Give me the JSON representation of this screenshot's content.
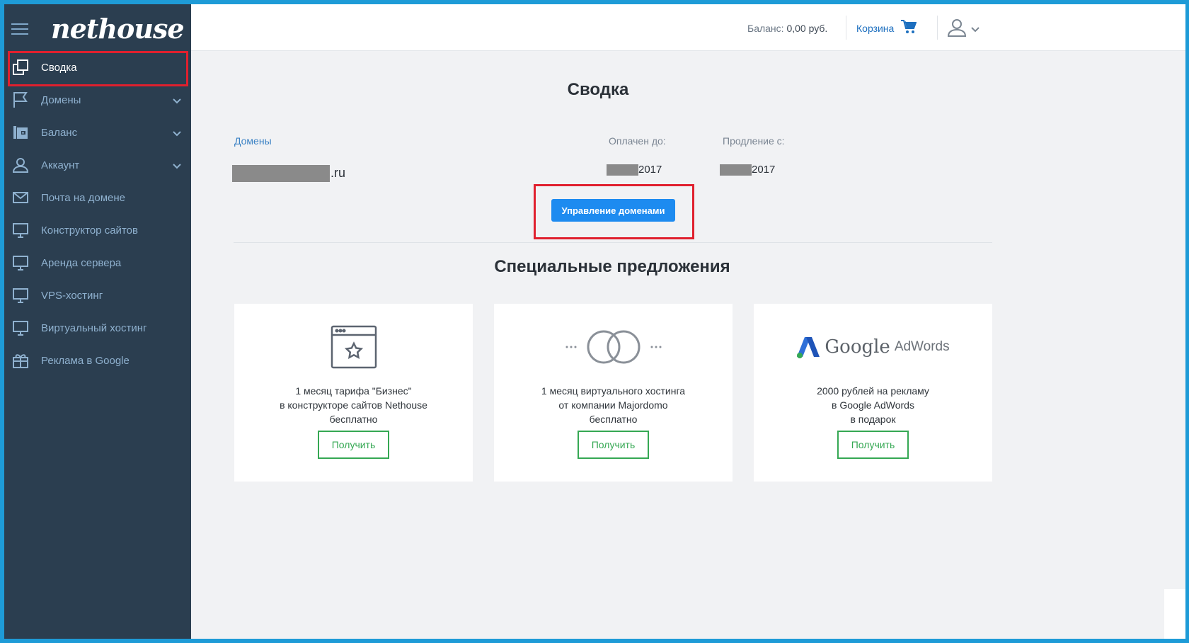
{
  "brand": {
    "logo": "nethouse"
  },
  "sidebar": {
    "items": [
      {
        "label": "Сводка",
        "icon": "copy-icon"
      },
      {
        "label": "Домены",
        "icon": "flag-icon"
      },
      {
        "label": "Баланс",
        "icon": "wallet-icon"
      },
      {
        "label": "Аккаунт",
        "icon": "user-icon"
      },
      {
        "label": "Почта на домене",
        "icon": "mail-icon"
      },
      {
        "label": "Конструктор сайтов",
        "icon": "monitor-icon"
      },
      {
        "label": "Аренда сервера",
        "icon": "monitor-icon"
      },
      {
        "label": "VPS-хостинг",
        "icon": "monitor-icon"
      },
      {
        "label": "Виртуальный хостинг",
        "icon": "monitor-icon"
      },
      {
        "label": "Реклама в Google",
        "icon": "gift-icon"
      }
    ]
  },
  "header": {
    "balance_label": "Баланс:",
    "balance_value": "0,00 руб.",
    "cart_label": "Корзина"
  },
  "summary": {
    "title": "Сводка",
    "col_domains": "Домены",
    "col_paid_until": "Оплачен до:",
    "col_renewal_from": "Продление с:",
    "domain_suffix": ".ru",
    "paid_year": "2017",
    "renewal_year": "2017",
    "manage_button": "Управление доменами"
  },
  "offers": {
    "title": "Специальные предложения",
    "cards": [
      {
        "line1": "1 месяц тарифа \"Бизнес\"",
        "line2": "в конструкторе сайтов Nethouse",
        "line3": "бесплатно",
        "button": "Получить"
      },
      {
        "line1": "1 месяц виртуального хостинга",
        "line2": "от компании Majordomo",
        "line3": "бесплатно",
        "button": "Получить"
      },
      {
        "line1": "2000 рублей на рекламу",
        "line2": "в Google AdWords",
        "line3": "в подарок",
        "button": "Получить",
        "logo_google": "Google",
        "logo_adwords": "AdWords"
      }
    ]
  }
}
